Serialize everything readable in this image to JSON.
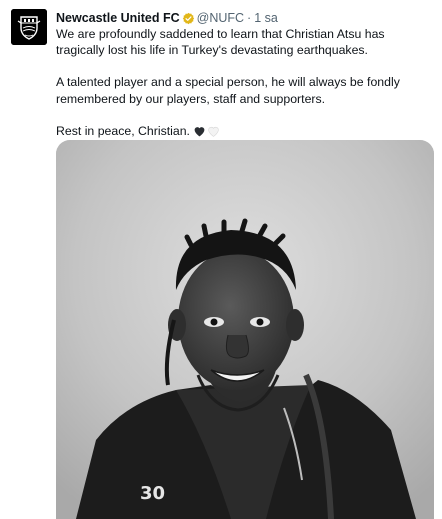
{
  "tweet": {
    "author_name": "Newcastle United FC",
    "verified_icon": "verified-badge-icon",
    "handle": "@NUFC",
    "separator": "·",
    "timestamp": "1 sa",
    "paragraphs": [
      "We are profoundly saddened to learn that Christian Atsu has tragically lost his life in Turkey's devastating earthquakes.",
      "A talented player and a special person, he will always be fondly remembered by our players, staff and supporters.",
      "Rest in peace, Christian."
    ],
    "emoji_icons": [
      "black-heart-icon",
      "white-heart-icon"
    ],
    "photo_shirt_number": "30"
  },
  "colors": {
    "text": "#0f1419",
    "secondary_text": "#536471",
    "verified_gold": "#e2b719",
    "background": "#ffffff"
  }
}
